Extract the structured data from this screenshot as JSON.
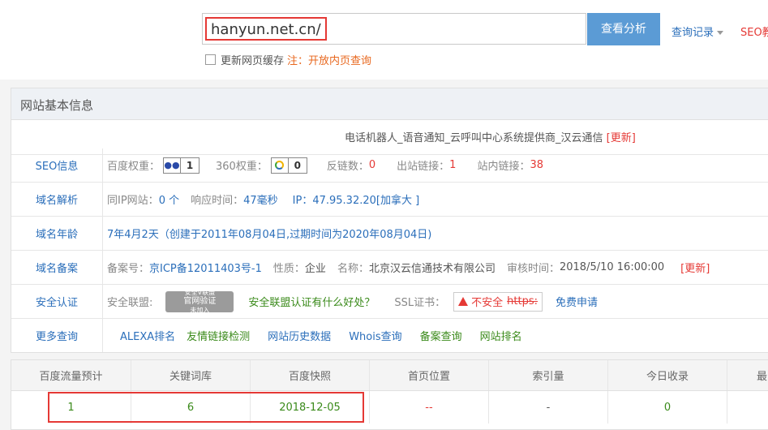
{
  "search": {
    "value": "hanyun.net.cn/",
    "button": "查看分析",
    "history": "查询记录",
    "seo_link": "SEO教程",
    "cache_label": "更新网页缓存",
    "note_label": "注：开放内页查询"
  },
  "panel": {
    "title": "网站基本信息",
    "site_title": "电话机器人_语音通知_云呼叫中心系统提供商_汉云通信",
    "update": "[更新]"
  },
  "seo": {
    "label": "SEO信息",
    "baidu_k": "百度权重：",
    "baidu_v": "1",
    "s360_k": "360权重：",
    "s360_v": "0",
    "backlinks_k": "反链数：",
    "backlinks_v": "0",
    "outlinks_k": "出站链接：",
    "outlinks_v": "1",
    "inlinks_k": "站内链接：",
    "inlinks_v": "38"
  },
  "dns": {
    "label": "域名解析",
    "sameip_k": "同IP网站：",
    "sameip_v": "0 个",
    "resp_k": "响应时间：",
    "resp_v": "47毫秒",
    "ip": "IP：47.95.32.20[加拿大 ]"
  },
  "age": {
    "label": "域名年龄",
    "value": "7年4月2天（创建于2011年08月04日,过期时间为2020年08月04日)"
  },
  "icp": {
    "label": "域名备案",
    "no_k": "备案号：",
    "no_v": "京ICP备12011403号-1",
    "nature_k": "性质：",
    "nature_v": "企业",
    "name_k": "名称：",
    "name_v": "北京汉云信通技术有限公司",
    "time_k": "审核时间：",
    "time_v": "2018/5/10 16:00:00",
    "update": "[更新]"
  },
  "security": {
    "label": "安全认证",
    "alliance_k": "安全联盟:",
    "seal_top": "安全V联盟",
    "seal_mid": "官网验证",
    "seal_bot": "未加入",
    "alliance_link": "安全联盟认证有什么好处？",
    "ssl_k": "SSL证书：",
    "ssl_badge": "不安全",
    "ssl_https": "https:",
    "apply": "免费申请"
  },
  "more": {
    "label": "更多查询",
    "links": [
      "ALEXA排名",
      "友情链接检测",
      "网站历史数据",
      "Whois查询",
      "备案查询",
      "网站排名"
    ]
  },
  "stats": {
    "headers": [
      "百度流量预计",
      "关键词库",
      "百度快照",
      "首页位置",
      "索引量",
      "今日收录",
      "最"
    ],
    "values": [
      "1",
      "6",
      "2018-12-05",
      "--",
      "-",
      "0",
      ""
    ]
  }
}
